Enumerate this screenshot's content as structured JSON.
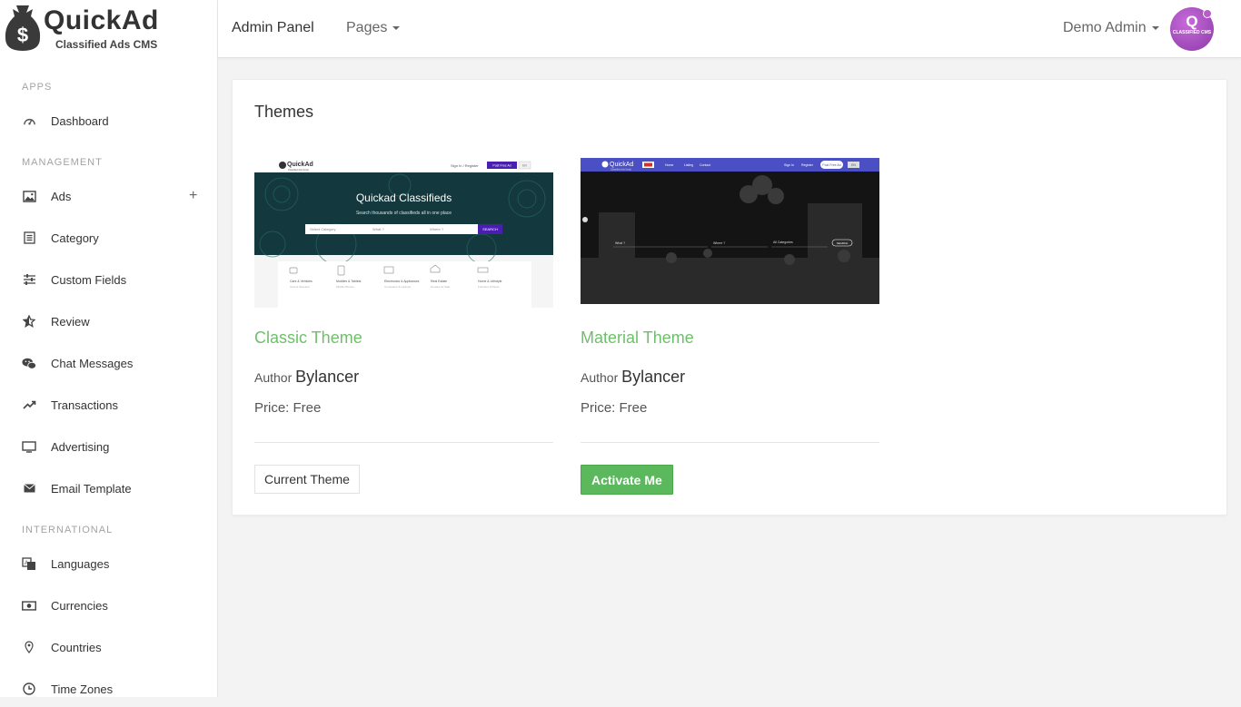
{
  "brand": {
    "name": "QuickAd",
    "subtitle": "Classified Ads CMS"
  },
  "sidebar": {
    "sections": [
      {
        "title": "APPS",
        "items": [
          {
            "label": "Dashboard",
            "icon": "dashboard-icon"
          }
        ]
      },
      {
        "title": "MANAGEMENT",
        "items": [
          {
            "label": "Ads",
            "icon": "image-icon",
            "expand": "+"
          },
          {
            "label": "Category",
            "icon": "list-icon"
          },
          {
            "label": "Custom Fields",
            "icon": "sliders-icon"
          },
          {
            "label": "Review",
            "icon": "star-icon"
          },
          {
            "label": "Chat Messages",
            "icon": "chat-icon"
          },
          {
            "label": "Transactions",
            "icon": "trending-icon"
          },
          {
            "label": "Advertising",
            "icon": "monitor-icon"
          },
          {
            "label": "Email Template",
            "icon": "envelope-icon"
          }
        ]
      },
      {
        "title": "INTERNATIONAL",
        "items": [
          {
            "label": "Languages",
            "icon": "translate-icon"
          },
          {
            "label": "Currencies",
            "icon": "money-icon"
          },
          {
            "label": "Countries",
            "icon": "map-pin-icon"
          },
          {
            "label": "Time Zones",
            "icon": "clock-icon"
          }
        ]
      }
    ]
  },
  "topbar": {
    "title": "Admin Panel",
    "pages_menu": "Pages",
    "user_name": "Demo Admin",
    "avatar_letter": "Q",
    "avatar_text": "CLASSIFIED CMS"
  },
  "main": {
    "title": "Themes",
    "themes": [
      {
        "name": "Classic Theme",
        "author_label": "Author",
        "author": "Bylancer",
        "price": "Price: Free",
        "button": "Current Theme",
        "preview": {
          "brand": "QuickAd",
          "brand_sub": "Classified Ads Script",
          "nav_signin": "Sign In / Register",
          "nav_post": "Post Free Ad",
          "nav_lang": "EN",
          "hero_title": "Quickad Classifieds",
          "hero_sub": "Search thousands of classifieds all in one place",
          "search_cat": "Select Category",
          "search_what": "What ?",
          "search_where": "Where ?",
          "search_btn": "SEARCH",
          "categories": [
            {
              "name": "Cars & Vehicles",
              "sub": "Cars & Scooters"
            },
            {
              "name": "Mobiles & Tablets",
              "sub": "Mobile Phones"
            },
            {
              "name": "Electronics & Appliances",
              "sub": "Computers & Laptops"
            },
            {
              "name": "Real Estate",
              "sub": "Houses for Sale"
            },
            {
              "name": "Home & Lifestyle",
              "sub": "Furniture & Decor"
            }
          ]
        }
      },
      {
        "name": "Material Theme",
        "author_label": "Author",
        "author": "Bylancer",
        "price": "Price: Free",
        "button": "Activate Me",
        "preview": {
          "brand": "QuickAd",
          "brand_sub": "Classified Ads Script",
          "nav_items": [
            "Home",
            "Listing",
            "Contact"
          ],
          "nav_signin": "Sign In",
          "nav_register": "Register",
          "nav_post": "Post Free Ad",
          "nav_lang": "EN",
          "search_what": "What ?",
          "search_where": "Where ?",
          "search_cat": "All Categories",
          "search_btn": "SEARCH"
        }
      }
    ]
  },
  "colors": {
    "accent_green": "#6fbf6a",
    "button_green": "#5cb85c",
    "material_header": "#4a4fc4",
    "classic_button": "#4a1fb0"
  }
}
